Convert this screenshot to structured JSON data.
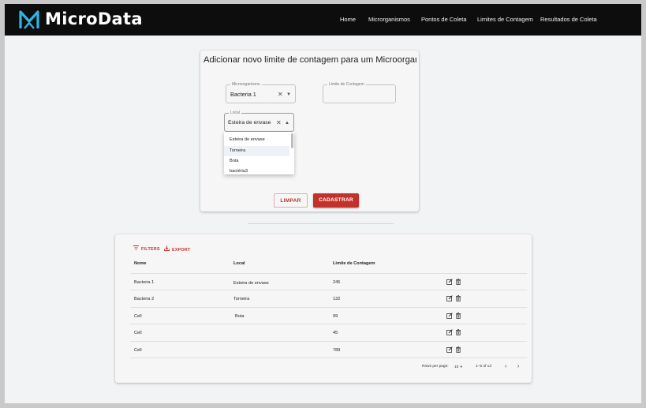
{
  "app": {
    "brand": "MicroData"
  },
  "nav": {
    "items": [
      "Home",
      "Microrganismos",
      "Pontos de Coleta",
      "Limites de Contagem",
      "Resultados de Coleta"
    ]
  },
  "form": {
    "title": "Adicionar novo limite de contagem para um Microorganismo",
    "microorganismo": {
      "label": "Microorganismo",
      "value": "Bacteria 1"
    },
    "limite": {
      "label": "Limite de Contagem",
      "value": ""
    },
    "local": {
      "label": "Local",
      "value": "Esteira de envase"
    },
    "dropdown_options": [
      "Esteira de envase",
      "Torneira",
      "Bota",
      "bactéria3"
    ],
    "clear_label": "LIMPAR",
    "submit_label": "CADASTRAR"
  },
  "table": {
    "filters_label": "FILTERS",
    "export_label": "EXPORT",
    "columns": [
      "Nome",
      "Local",
      "Limite de Contagem"
    ],
    "rows": [
      {
        "nome": "Bacteria 1",
        "local": "Esteira de envase",
        "limite": "245"
      },
      {
        "nome": "Bacteria 2",
        "local": "Torneira",
        "limite": "132"
      },
      {
        "nome": "Cell",
        "local": "Bota",
        "limite": "99"
      },
      {
        "nome": "Cell",
        "local": "",
        "limite": "45"
      },
      {
        "nome": "Cell",
        "local": "",
        "limite": "789"
      }
    ],
    "pagination": {
      "rows_per_page_label": "Rows per page:",
      "rows_per_page": "10",
      "range": "1–5 of 13"
    }
  },
  "colors": {
    "accent": "#c4312a",
    "navbar": "#0d0d0d",
    "logo": "#2fb4e6"
  },
  "icons": [
    "microdata-logo-icon",
    "clear-icon",
    "dropdown-arrow-icon",
    "filter-icon",
    "export-icon",
    "edit-icon",
    "delete-icon",
    "chevron-left-icon",
    "chevron-right-icon"
  ]
}
